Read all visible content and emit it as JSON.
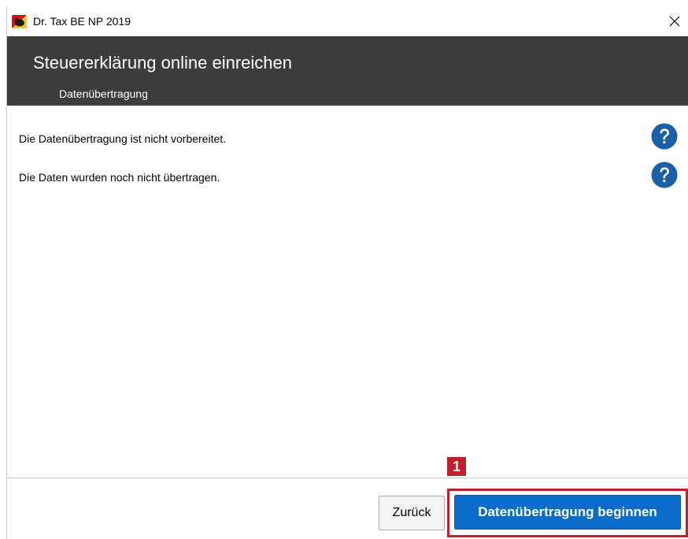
{
  "window": {
    "title": "Dr. Tax BE NP 2019"
  },
  "header": {
    "title": "Steuererklärung online einreichen",
    "subtitle": "Datenübertragung"
  },
  "content": {
    "status_lines": [
      "Die Datenübertragung ist nicht vorbereitet.",
      "Die Daten wurden noch nicht übertragen."
    ]
  },
  "footer": {
    "back_label": "Zurück",
    "start_label": "Datenübertragung beginnen",
    "marker_number": "1"
  },
  "icons": {
    "app": "bear-shield-icon",
    "close": "close-icon",
    "help": "help-icon"
  },
  "colors": {
    "header_bg": "#3c3c3c",
    "primary_button": "#0a6cc8",
    "help_icon": "#1a5fa8",
    "highlight": "#c0202e"
  }
}
